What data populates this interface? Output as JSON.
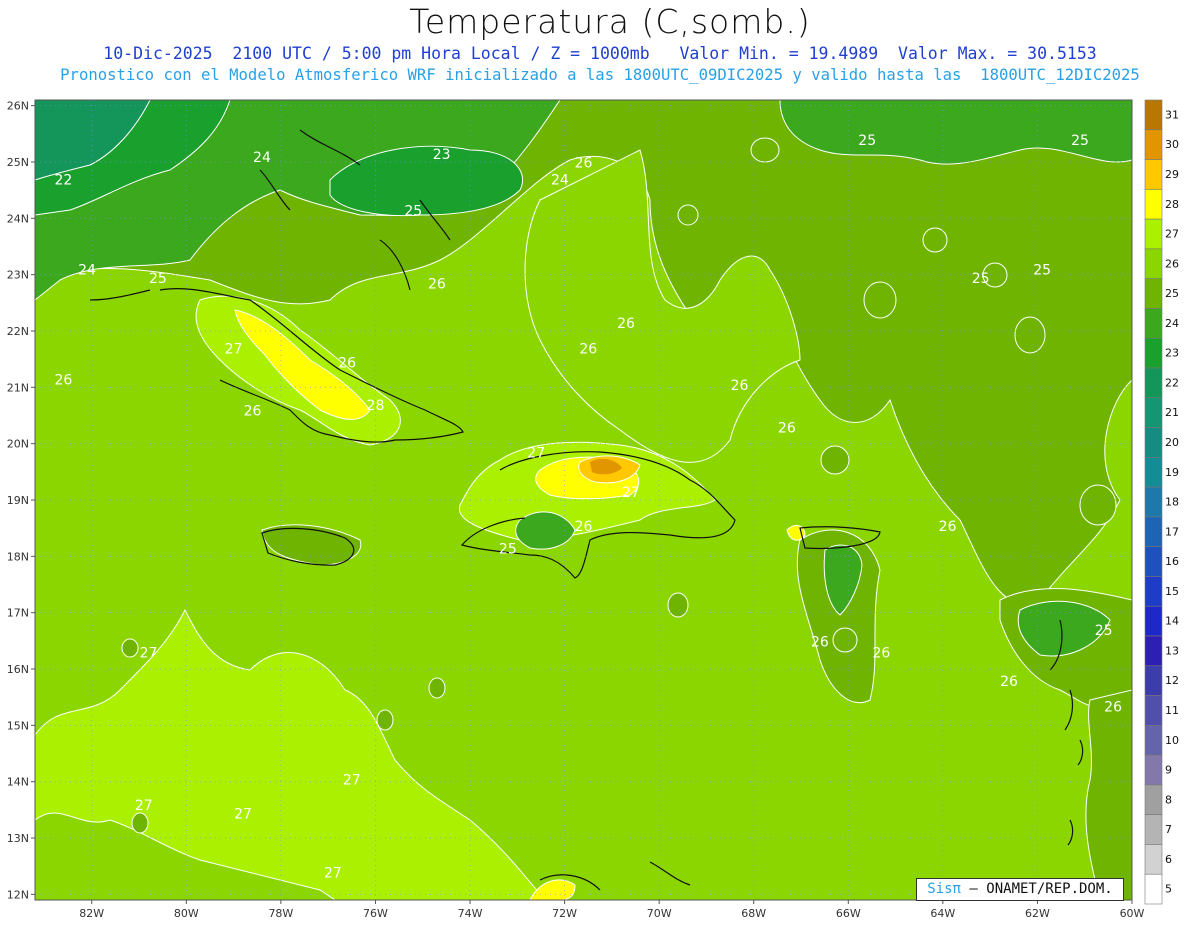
{
  "header": {
    "title": "Temperatura (C,somb.)",
    "line1": "10-Dic-2025  2100 UTC / 5:00 pm Hora Local / Z = 1000mb   Valor Min. = 19.4989  Valor Max. = 30.5153",
    "line2": "Pronostico con el Modelo Atmosferico WRF inicializado a las 1800UTC_09DIC2025 y valido hasta las  1800UTC_12DIC2025"
  },
  "map": {
    "lat_labels": [
      "26N",
      "25N",
      "24N",
      "23N",
      "22N",
      "21N",
      "20N",
      "19N",
      "18N",
      "17N",
      "16N",
      "15N",
      "14N",
      "13N",
      "12N"
    ],
    "lon_labels": [
      "82W",
      "80W",
      "78W",
      "76W",
      "74W",
      "72W",
      "70W",
      "68W",
      "66W",
      "64W",
      "62W",
      "60W"
    ],
    "lon_range": [
      -83.2,
      -60
    ],
    "lat_range": [
      11.9,
      26.1
    ],
    "contour_labels": [
      {
        "text": "22",
        "lon": -82.6,
        "lat": 24.6
      },
      {
        "text": "24",
        "lon": -78.4,
        "lat": 25.0
      },
      {
        "text": "23",
        "lon": -74.6,
        "lat": 25.05
      },
      {
        "text": "24",
        "lon": -72.1,
        "lat": 24.6
      },
      {
        "text": "25",
        "lon": -75.2,
        "lat": 24.05
      },
      {
        "text": "26",
        "lon": -71.6,
        "lat": 24.9
      },
      {
        "text": "25",
        "lon": -65.6,
        "lat": 25.3
      },
      {
        "text": "25",
        "lon": -61.1,
        "lat": 25.3
      },
      {
        "text": "25",
        "lon": -63.2,
        "lat": 22.85
      },
      {
        "text": "25",
        "lon": -61.9,
        "lat": 23.0
      },
      {
        "text": "24",
        "lon": -82.1,
        "lat": 23.0
      },
      {
        "text": "25",
        "lon": -80.6,
        "lat": 22.85
      },
      {
        "text": "26",
        "lon": -74.7,
        "lat": 22.75
      },
      {
        "text": "26",
        "lon": -70.7,
        "lat": 22.05
      },
      {
        "text": "26",
        "lon": -71.5,
        "lat": 21.6
      },
      {
        "text": "27",
        "lon": -79.0,
        "lat": 21.6
      },
      {
        "text": "26",
        "lon": -76.6,
        "lat": 21.35
      },
      {
        "text": "26",
        "lon": -82.6,
        "lat": 21.05
      },
      {
        "text": "26",
        "lon": -68.3,
        "lat": 20.95
      },
      {
        "text": "26",
        "lon": -78.6,
        "lat": 20.5
      },
      {
        "text": "28",
        "lon": -76.0,
        "lat": 20.6
      },
      {
        "text": "26",
        "lon": -67.3,
        "lat": 20.2
      },
      {
        "text": "27",
        "lon": -72.6,
        "lat": 19.75
      },
      {
        "text": "27",
        "lon": -70.6,
        "lat": 19.05
      },
      {
        "text": "26",
        "lon": -71.6,
        "lat": 18.45
      },
      {
        "text": "25",
        "lon": -73.2,
        "lat": 18.05
      },
      {
        "text": "26",
        "lon": -63.9,
        "lat": 18.45
      },
      {
        "text": "26",
        "lon": -66.6,
        "lat": 16.4
      },
      {
        "text": "26",
        "lon": -65.3,
        "lat": 16.2
      },
      {
        "text": "25",
        "lon": -60.6,
        "lat": 16.6
      },
      {
        "text": "26",
        "lon": -62.6,
        "lat": 15.7
      },
      {
        "text": "26",
        "lon": -60.4,
        "lat": 15.25
      },
      {
        "text": "27",
        "lon": -80.8,
        "lat": 16.2
      },
      {
        "text": "27",
        "lon": -80.9,
        "lat": 13.5
      },
      {
        "text": "27",
        "lon": -78.8,
        "lat": 13.35
      },
      {
        "text": "27",
        "lon": -76.5,
        "lat": 13.95
      },
      {
        "text": "27",
        "lon": -76.9,
        "lat": 12.3
      }
    ]
  },
  "legend": {
    "levels": [
      "31",
      "30",
      "29",
      "28",
      "27",
      "26",
      "25",
      "24",
      "23",
      "22",
      "21",
      "20",
      "19",
      "18",
      "17",
      "16",
      "15",
      "14",
      "13",
      "12",
      "11",
      "10",
      "9",
      "8",
      "7",
      "6",
      "5"
    ],
    "colors": [
      "#b87800",
      "#e19600",
      "#ffc800",
      "#ffff00",
      "#aaf000",
      "#8cd600",
      "#6eb400",
      "#3ca81e",
      "#19a02d",
      "#14965a",
      "#149673",
      "#148c82",
      "#148c96",
      "#1e78aa",
      "#1e64b4",
      "#1e50be",
      "#1e3cc8",
      "#1e28c8",
      "#2d1eb4",
      "#3c3caa",
      "#5050aa",
      "#6464aa",
      "#8278aa",
      "#a0a0a0",
      "#b4b4b4",
      "#d2d2d2",
      "#ffffff"
    ]
  },
  "credit": {
    "sis": "Sisπ",
    "rest": "– ONAMET/REP.DOM."
  }
}
